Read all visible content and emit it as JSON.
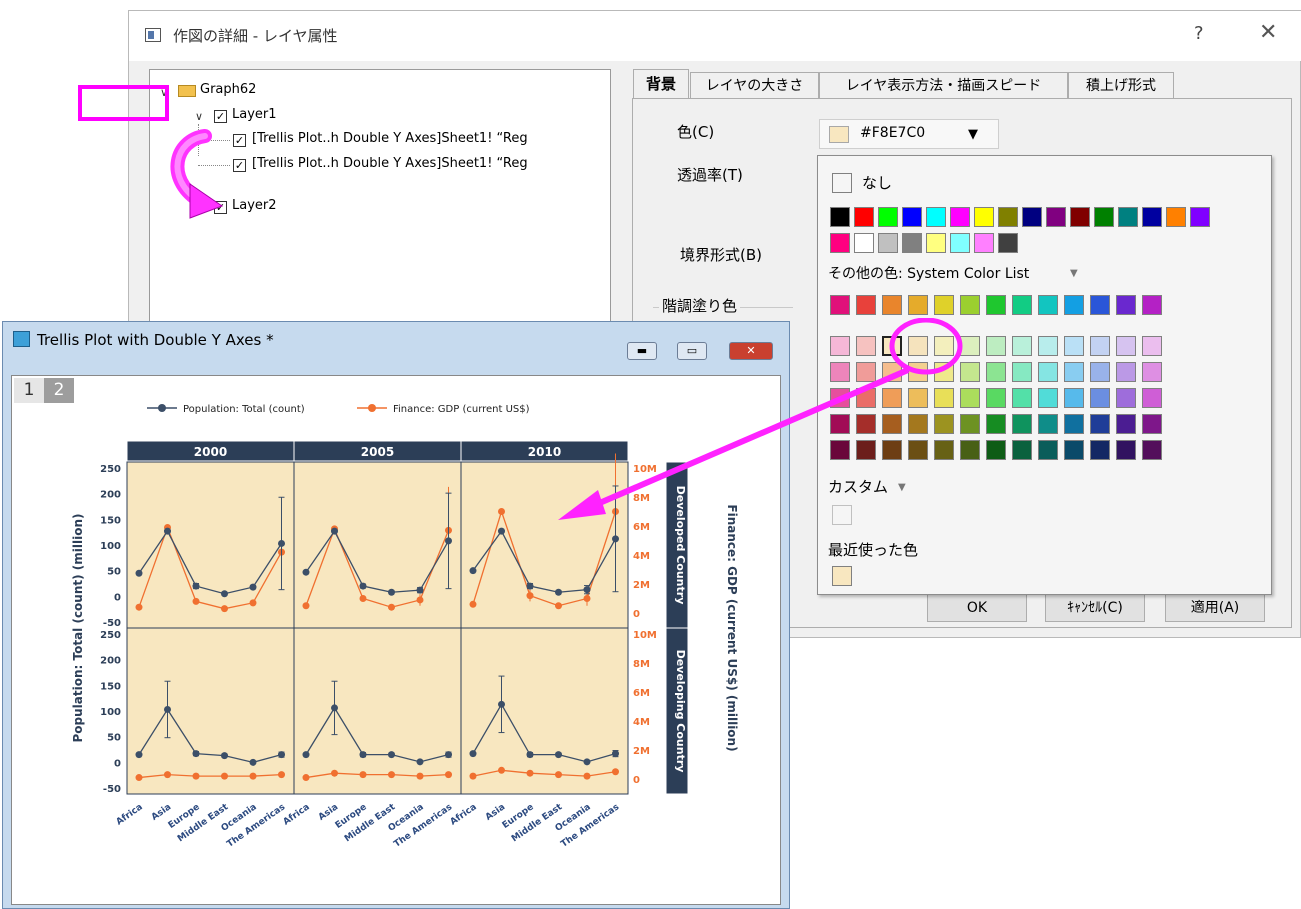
{
  "dialog": {
    "title": "作図の詳細 - レイヤ属性",
    "help": "?",
    "close": "✕",
    "tree": {
      "root": "Graph62",
      "layer1": "Layer1",
      "plot1": "[Trellis Plot..h Double Y Axes]Sheet1! “Reg",
      "plot2": "[Trellis Plot..h Double Y Axes]Sheet1! “Reg",
      "layer2": "Layer2"
    },
    "tabs": [
      "背景",
      "レイヤの大きさ",
      "レイヤ表示方法・描画スピード",
      "積上げ形式"
    ],
    "labels": {
      "color": "色(C)",
      "transparency": "透過率(T)",
      "border": "境界形式(B)",
      "gradient": "階調塗り色"
    },
    "color_value": "#F8E7C0",
    "buttons": {
      "ok": "OK",
      "cancel": "ｷｬﾝｾﾙ(C)",
      "apply": "適用(A)"
    }
  },
  "popup": {
    "none_label": "なし",
    "other_colors_label": "その他の色: System Color List",
    "custom_label": "カスタム",
    "recent_label": "最近使った色",
    "basic_colors": [
      "#000000",
      "#ff0000",
      "#00ff00",
      "#0000ff",
      "#00ffff",
      "#ff00ff",
      "#ffff00",
      "#808000",
      "#000080",
      "#800080",
      "#800000",
      "#008000",
      "#008080",
      "#0000a0",
      "#ff8000",
      "#8000ff",
      "#ff0080",
      "#ffffff",
      "#c0c0c0",
      "#808080",
      "#ffff80",
      "#80ffff",
      "#ff80ff",
      "#404040"
    ],
    "system_row": [
      "#e0117a",
      "#e8413b",
      "#e9852c",
      "#e5ab2b",
      "#dfd12a",
      "#9bcf2f",
      "#1fc72f",
      "#12cc84",
      "#12c5c0",
      "#139fe3",
      "#2a56d8",
      "#6a28cf",
      "#b421c5"
    ],
    "tint_rows": [
      [
        "#f5b7d7",
        "#f6c2c0",
        "#F8E7C0",
        "#f5e3bd",
        "#f3efbd",
        "#dcefbe",
        "#bdedc1",
        "#b9f0da",
        "#b8edec",
        "#bae0f6",
        "#c3d2f2",
        "#d6c3f0",
        "#ebbeee"
      ],
      [
        "#ee85bb",
        "#f09c99",
        "#f5bd8d",
        "#f3d08e",
        "#efe98b",
        "#c4e78e",
        "#8ce492",
        "#86e9c2",
        "#85e5e3",
        "#89cdf1",
        "#99b2ea",
        "#bb99e6",
        "#de8fe3"
      ],
      [
        "#e64f9d",
        "#ea6d68",
        "#ef9d58",
        "#edbd5b",
        "#e8df58",
        "#abdd5c",
        "#59d962",
        "#53e0a8",
        "#51dcd8",
        "#57baeb",
        "#6b8ee1",
        "#9e6ddb",
        "#cf5ed6"
      ],
      [
        "#a10c56",
        "#a52e2a",
        "#a65e1f",
        "#a4781e",
        "#9c9320",
        "#6d9222",
        "#168c22",
        "#0f935e",
        "#0f8d89",
        "#10709f",
        "#1f3d98",
        "#4b1d92",
        "#7e178a"
      ],
      [
        "#6a073a",
        "#6c1e1b",
        "#6d3e14",
        "#6b4f14",
        "#676115",
        "#486016",
        "#0e5c16",
        "#0a613e",
        "#0a5d5a",
        "#0a4a69",
        "#142864",
        "#311360",
        "#530f5b"
      ]
    ],
    "recent_color": "#F8E7C0"
  },
  "graph_window": {
    "title": "Trellis Plot with Double Y Axes *",
    "pages": [
      "1",
      "2"
    ]
  },
  "chart_data": {
    "type": "line",
    "panel_columns": [
      "2000",
      "2005",
      "2010"
    ],
    "panel_rows": [
      "Developed Country",
      "Developing Country"
    ],
    "categories": [
      "Africa",
      "Asia",
      "Europe",
      "Middle East",
      "Oceania",
      "The Americas"
    ],
    "series": [
      {
        "name": "Population: Total (count)",
        "color": "#3c4f68"
      },
      {
        "name": "Finance: GDP (current US$)",
        "color": "#f07030"
      }
    ],
    "ylabel": "Population: Total (count) (million)",
    "y2label": "Finance: GDP (current US$) (million)",
    "ylim": [
      -50,
      250
    ],
    "y2lim": [
      0,
      10
    ],
    "y_ticks": [
      "250",
      "200",
      "150",
      "100",
      "50",
      "0",
      "-50"
    ],
    "y2_ticks": [
      "10M",
      "8M",
      "6M",
      "4M",
      "2M",
      "0"
    ],
    "panels": {
      "Developed Country": {
        "2000": {
          "pop": [
            45,
            127,
            20,
            5,
            18,
            103
          ],
          "pop_err": [
            0,
            0,
            5,
            3,
            3,
            90
          ],
          "gdp": [
            0.4,
            5.9,
            0.8,
            0.3,
            0.7,
            4.2
          ],
          "gdp_err": [
            0,
            0,
            0,
            0,
            0,
            2.5
          ]
        },
        "2005": {
          "pop": [
            47,
            127,
            20,
            8,
            12,
            108
          ],
          "pop_err": [
            0,
            0,
            4,
            3,
            5,
            93
          ],
          "gdp": [
            0.5,
            5.8,
            1.0,
            0.4,
            0.9,
            5.7
          ],
          "gdp_err": [
            0,
            0,
            0,
            0,
            0.4,
            3.0
          ]
        },
        "2010": {
          "pop": [
            50,
            127,
            20,
            8,
            13,
            112
          ],
          "pop_err": [
            0,
            0,
            5,
            3,
            8,
            103
          ],
          "gdp": [
            0.6,
            7.0,
            1.2,
            0.5,
            1.0,
            7.0
          ],
          "gdp_err": [
            0,
            0,
            0.4,
            0,
            0.5,
            4.0
          ]
        }
      },
      "Developing Country": {
        "2000": {
          "pop": [
            15,
            103,
            17,
            13,
            0,
            15
          ],
          "pop_err": [
            0,
            55,
            4,
            3,
            0,
            5
          ],
          "gdp": [
            0.1,
            0.3,
            0.2,
            0.2,
            0.2,
            0.3
          ],
          "gdp_err": [
            0,
            0,
            0,
            0,
            0,
            0
          ]
        },
        "2005": {
          "pop": [
            15,
            106,
            15,
            15,
            1,
            15
          ],
          "pop_err": [
            0,
            52,
            4,
            3,
            0,
            5
          ],
          "gdp": [
            0.1,
            0.4,
            0.3,
            0.3,
            0.2,
            0.3
          ],
          "gdp_err": [
            0,
            0,
            0,
            0,
            0,
            0
          ]
        },
        "2010": {
          "pop": [
            17,
            113,
            15,
            15,
            1,
            17
          ],
          "pop_err": [
            0,
            55,
            4,
            3,
            0,
            6
          ],
          "gdp": [
            0.2,
            0.6,
            0.4,
            0.3,
            0.2,
            0.5
          ],
          "gdp_err": [
            0,
            0,
            0,
            0,
            0,
            0
          ]
        }
      }
    },
    "legend_position": "top",
    "panel_background": "#F8E7C0"
  }
}
